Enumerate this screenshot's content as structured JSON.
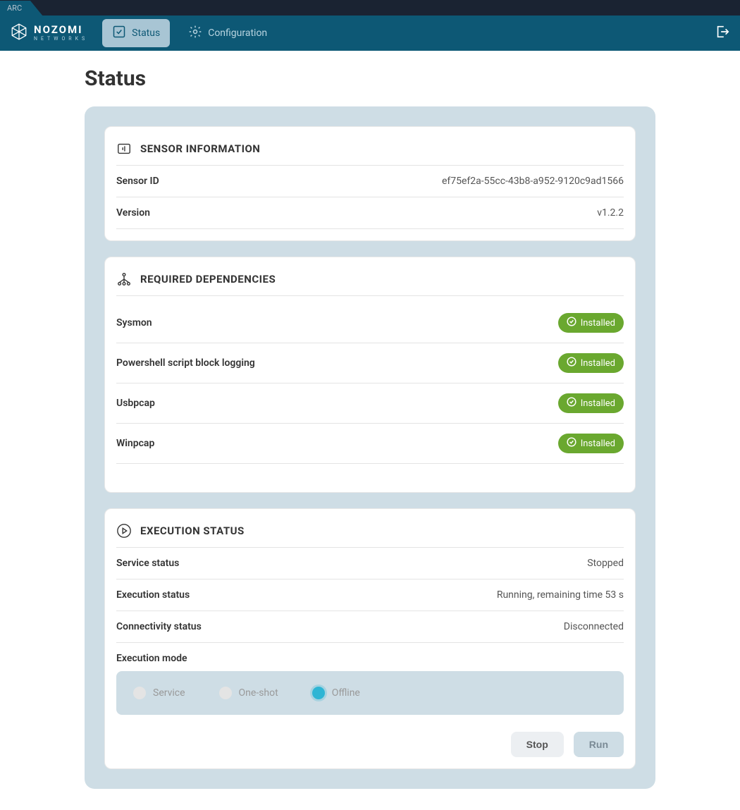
{
  "topTab": "ARC",
  "brand": {
    "main": "NOZOMI",
    "sub": "NETWORKS"
  },
  "nav": {
    "status": "Status",
    "configuration": "Configuration"
  },
  "pageTitle": "Status",
  "sensorCard": {
    "title": "SENSOR INFORMATION",
    "rows": {
      "sensorIdLabel": "Sensor ID",
      "sensorIdValue": "ef75ef2a-55cc-43b8-a952-9120c9ad1566",
      "versionLabel": "Version",
      "versionValue": "v1.2.2"
    }
  },
  "depsCard": {
    "title": "REQUIRED DEPENDENCIES",
    "items": [
      {
        "name": "Sysmon",
        "status": "Installed"
      },
      {
        "name": "Powershell script block logging",
        "status": "Installed"
      },
      {
        "name": "Usbpcap",
        "status": "Installed"
      },
      {
        "name": "Winpcap",
        "status": "Installed"
      }
    ]
  },
  "execCard": {
    "title": "EXECUTION STATUS",
    "serviceStatusLabel": "Service status",
    "serviceStatusValue": "Stopped",
    "execStatusLabel": "Execution status",
    "execStatusValue": "Running, remaining time 53 s",
    "connStatusLabel": "Connectivity status",
    "connStatusValue": "Disconnected",
    "execModeLabel": "Execution mode",
    "modes": {
      "service": "Service",
      "oneshot": "One-shot",
      "offline": "Offline"
    },
    "buttons": {
      "stop": "Stop",
      "run": "Run"
    }
  }
}
